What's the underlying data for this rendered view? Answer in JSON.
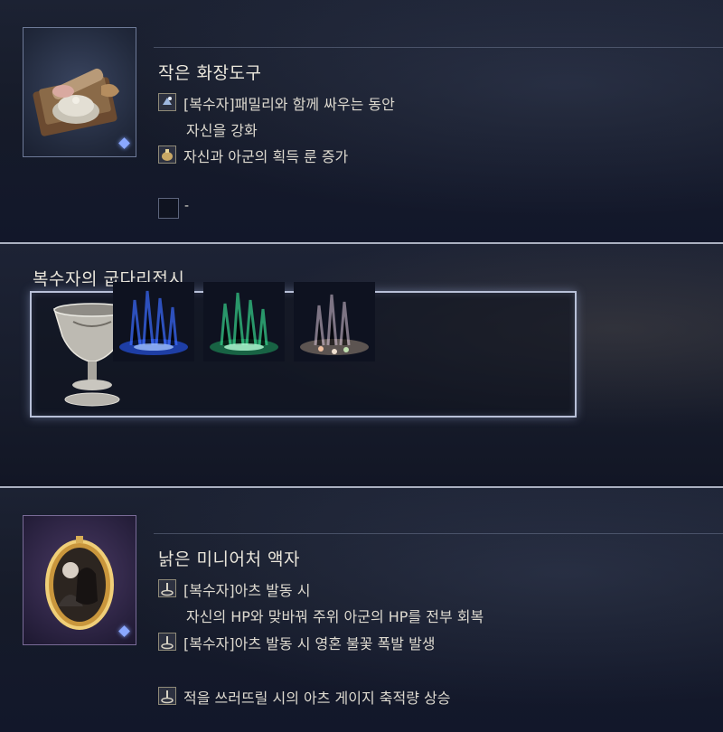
{
  "item1": {
    "name": "작은 화장도구",
    "effects": [
      {
        "icon": "ally-buff-icon",
        "lines": [
          "[복수자]패밀리와 함께 싸우는 동안",
          "자신을 강화"
        ]
      },
      {
        "icon": "rune-pouch-icon",
        "lines": [
          "자신과 아군의 획득 룬 증가"
        ]
      }
    ],
    "empty_slot_text": "-"
  },
  "item2": {
    "name": "복수자의 굽다리접시",
    "cells": [
      "chalice",
      "blue-effect",
      "green-effect",
      "iridescent-effect"
    ]
  },
  "item3": {
    "name": "낡은 미니어처 액자",
    "effects": [
      {
        "icon": "arts-icon",
        "lines": [
          "[복수자]아츠 발동 시",
          "자신의 HP와 맞바꿔 주위 아군의 HP를 전부 회복"
        ]
      },
      {
        "icon": "arts-icon",
        "lines": [
          "[복수자]아츠 발동 시 영혼 불꽃 폭발 발생"
        ]
      },
      {
        "icon": "arts-icon",
        "lines": [
          "적을 쓰러뜨릴 시의 아츠 게이지 축적량 상승"
        ]
      }
    ]
  },
  "colors": {
    "highlight_frame": "#b8c0d8",
    "separator": "#aab0c0",
    "rarity_gem": "#8aa8ff"
  }
}
